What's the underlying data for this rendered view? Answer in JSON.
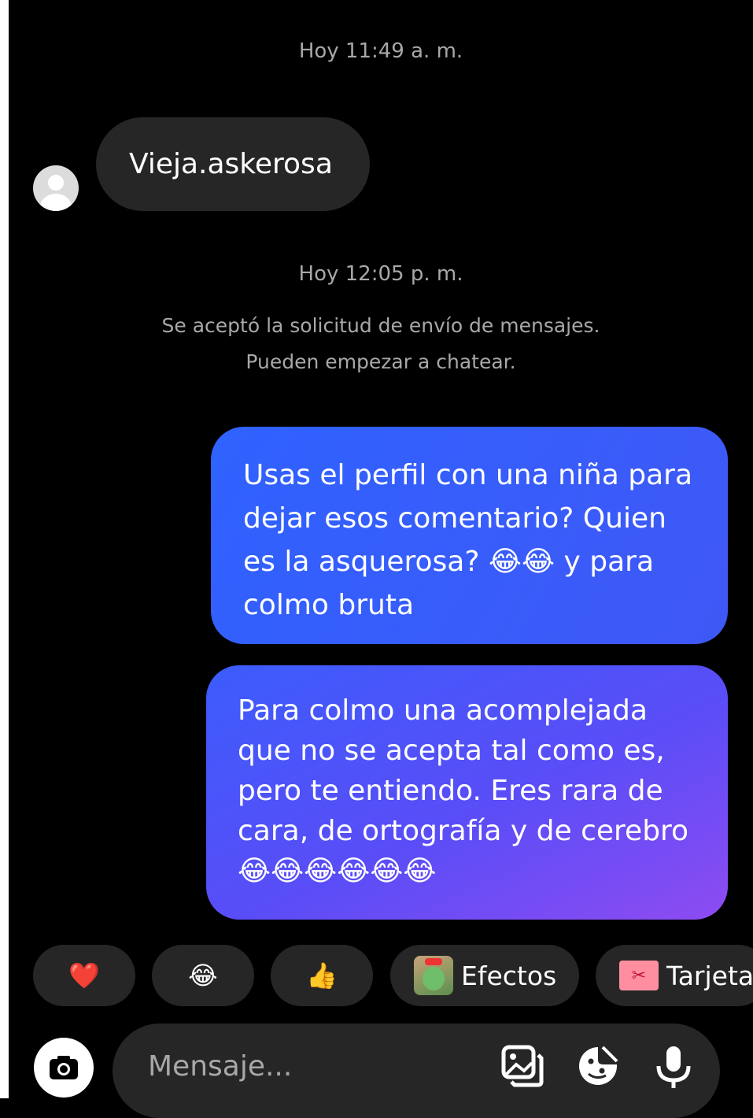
{
  "chat": {
    "timestamp_1": "Hoy 11:49 a. m.",
    "incoming_message": "Vieja.askerosa",
    "timestamp_2": "Hoy 12:05 p. m.",
    "system_line_1": "Se aceptó la solicitud de envío de mensajes.",
    "system_line_2": "Pueden empezar a chatear.",
    "outgoing_1": {
      "line_1": "Usas el perfil con una niña para",
      "line_2": "dejar esos comentario? Quien",
      "line_3_text": "es la asquerosa?",
      "line_3_emoji": "😂😂",
      "line_3_tail": "y para",
      "line_4": "colmo bruta"
    },
    "outgoing_2": {
      "line_1": "Para colmo una acomplejada",
      "line_2": "que no se acepta tal como es,",
      "line_3": "pero te entiendo. Eres rara de",
      "line_4": "cara, de ortografía y de cerebro",
      "line_5_emoji": "😂😂😂😂😂😂"
    }
  },
  "quick_replies": {
    "heart": "❤️",
    "laugh": "😂",
    "thumbs_up": "👍",
    "effects_label": "Efectos",
    "card_label": "Tarjeta"
  },
  "composer": {
    "placeholder": "Mensaje..."
  },
  "icons": [
    "camera-icon",
    "gallery-icon",
    "sticker-icon",
    "microphone-icon",
    "avatar-icon"
  ],
  "colors": {
    "background": "#000000",
    "incoming_bubble": "#262626",
    "outgoing_gradient_start": "#2f62ff",
    "outgoing_gradient_end": "#8e4cf1",
    "muted_text": "#a8a8a8"
  }
}
